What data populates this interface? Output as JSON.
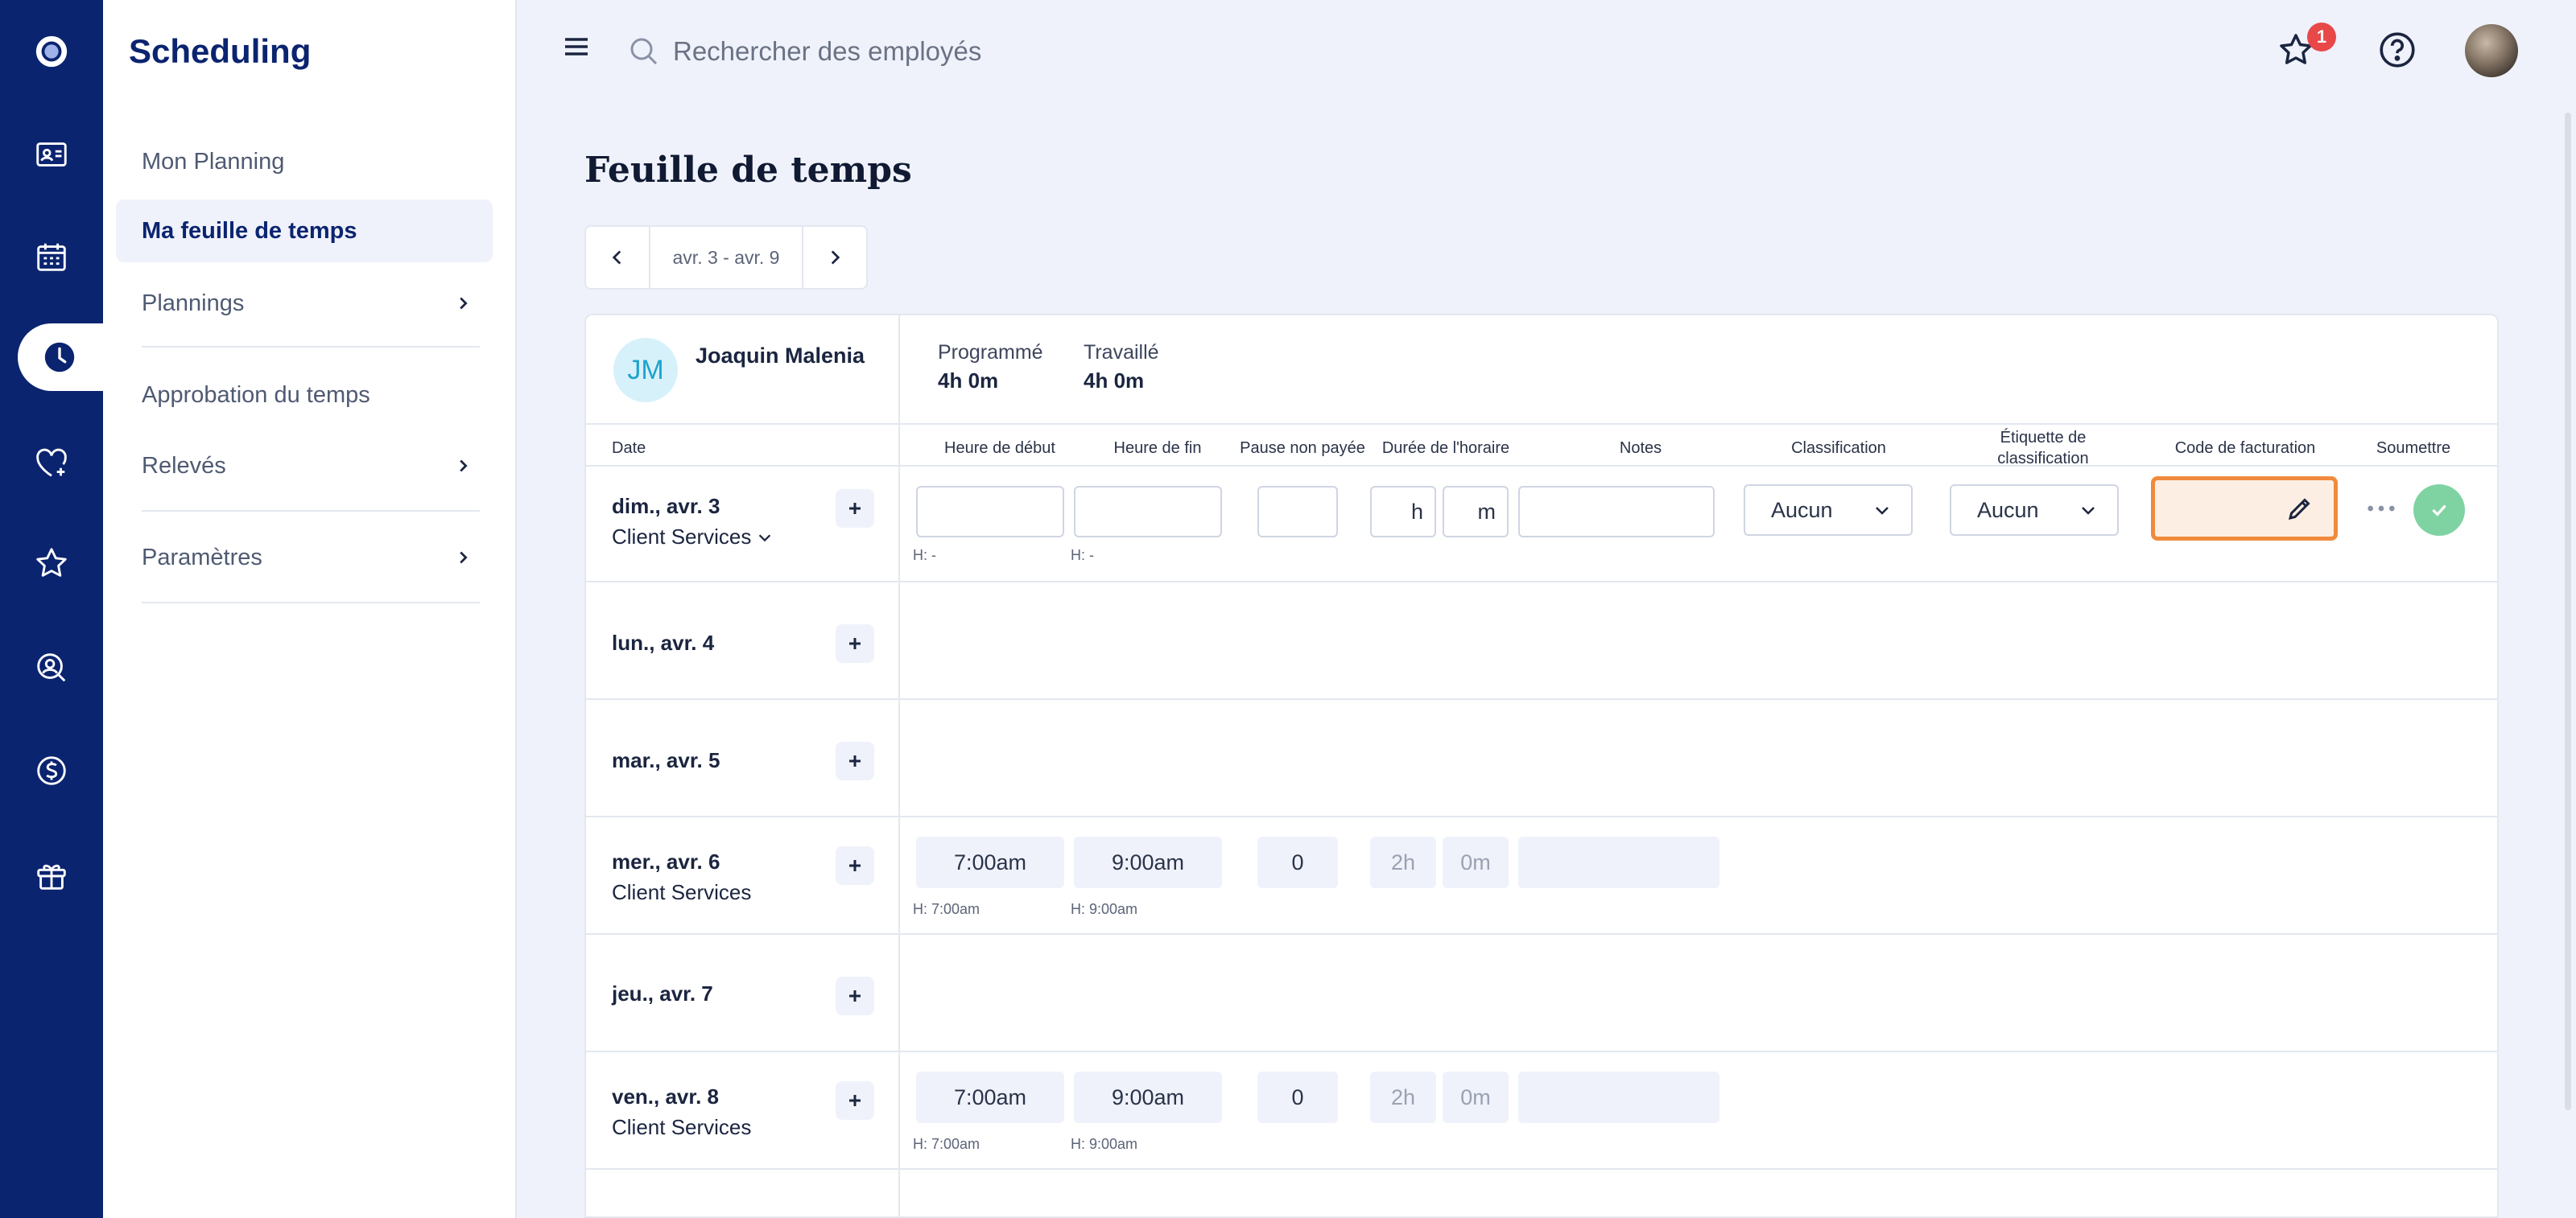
{
  "app": {
    "brand": "Scheduling"
  },
  "rail": {
    "items": [
      "logo-icon",
      "profile-card-icon",
      "calendar-icon",
      "clock-icon",
      "heart-plus-icon",
      "star-icon",
      "search-person-icon",
      "dollar-icon",
      "gift-icon"
    ],
    "active": "clock-icon"
  },
  "sidebar": {
    "items": [
      {
        "label": "Mon Planning",
        "active": false
      },
      {
        "label": "Ma feuille de temps",
        "active": true
      },
      {
        "label": "Plannings",
        "active": false,
        "expandable": true
      },
      {
        "label": "Approbation du temps",
        "active": false
      },
      {
        "label": "Relevés",
        "active": false,
        "expandable": true
      },
      {
        "label": "Paramètres",
        "active": false,
        "expandable": true
      }
    ]
  },
  "topbar": {
    "search_placeholder": "Rechercher des employés",
    "notification_count": "1"
  },
  "page": {
    "title": "Feuille de temps",
    "date_range": "avr. 3 - avr. 9"
  },
  "employee": {
    "initials": "JM",
    "name": "Joaquin Malenia"
  },
  "stats": {
    "scheduled_label": "Programmé",
    "scheduled_value": "4h 0m",
    "worked_label": "Travaillé",
    "worked_value": "4h 0m"
  },
  "columns": {
    "date": "Date",
    "start": "Heure de début",
    "end": "Heure de fin",
    "break": "Pause non payée",
    "duration": "Durée de l'horaire",
    "notes": "Notes",
    "classification": "Classification",
    "tag": "Étiquette de classification",
    "billing": "Code de facturation",
    "submit": "Soumettre"
  },
  "rows": [
    {
      "day": "dim., avr. 3",
      "dept": "Client Services",
      "editing": true,
      "start": "",
      "end": "",
      "start_hint": "H: -",
      "end_hint": "H: -",
      "break": "",
      "hours_unit": "h",
      "minutes_unit": "m",
      "notes": "",
      "classification": "Aucun",
      "tag": "Aucun"
    },
    {
      "day": "lun., avr. 4"
    },
    {
      "day": "mar., avr. 5"
    },
    {
      "day": "mer., avr. 6",
      "dept": "Client Services",
      "start": "7:00am",
      "end": "9:00am",
      "start_hint": "H: 7:00am",
      "end_hint": "H: 9:00am",
      "break": "0",
      "hours": "2h",
      "minutes": "0m"
    },
    {
      "day": "jeu., avr. 7"
    },
    {
      "day": "ven., avr. 8",
      "dept": "Client Services",
      "start": "7:00am",
      "end": "9:00am",
      "start_hint": "H: 7:00am",
      "end_hint": "H: 9:00am",
      "break": "0",
      "hours": "2h",
      "minutes": "0m"
    }
  ],
  "colors": {
    "rail": "#0b2470",
    "accent_orange": "#f08a3c",
    "submit_green": "#7fd3a2",
    "badge_red": "#e84848"
  }
}
